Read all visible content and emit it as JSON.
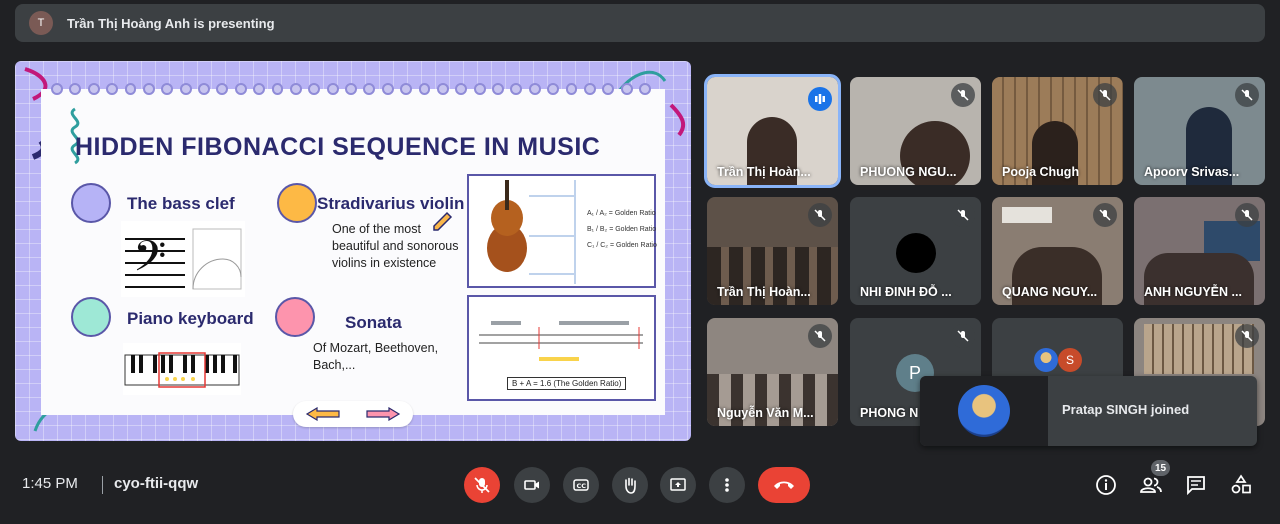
{
  "banner": {
    "presenter_initials": "T",
    "text": "Trần Thị Hoàng Anh is presenting"
  },
  "slide": {
    "title": "HIDDEN FIBONACCI SEQUENCE IN MUSIC",
    "bass_clef": "The bass clef",
    "violin_heading": "Stradivarius violin",
    "violin_text": "One of the most beautiful and sonorous violins in existence",
    "piano": "Piano keyboard",
    "sonata": "Sonata",
    "sonata_text": "Of Mozart, Beethoven, Bach,...",
    "ratio_lines": [
      "A₁ / A₂ = Golden Ratio",
      "B₁ / B₂ = Golden Ratio",
      "C₁ / C₂ = Golden Ratio"
    ],
    "golden_formula": "B + A = 1.6 (The Golden Ratio)",
    "accent_purple": "#b9b4f5",
    "circle_colors": [
      "#b6b3f6",
      "#fdb945",
      "#9ee8d6",
      "#fd94ad"
    ]
  },
  "participants": [
    {
      "name": "Trần Thị Hoàn...",
      "state": "speaking",
      "bg": "#d9d3cc"
    },
    {
      "name": "PHUONG NGU...",
      "state": "muted",
      "bg": "#b8b4ae"
    },
    {
      "name": "Pooja Chugh",
      "state": "muted",
      "bg": "#8b6f52"
    },
    {
      "name": "Apoorv Srivas...",
      "state": "muted",
      "bg": "#7d8a8f"
    },
    {
      "name": "Trần Thị Hoàn...",
      "state": "muted",
      "bg": "#5d5148"
    },
    {
      "name": "NHI ĐINH ĐỖ ...",
      "state": "muted",
      "bg": "#3c4043"
    },
    {
      "name": "QUANG NGUY...",
      "state": "muted",
      "bg": "#8a7d72"
    },
    {
      "name": "ANH NGUYỄN ...",
      "state": "muted",
      "bg": "#7b7071"
    },
    {
      "name": "Nguyễn Văn M...",
      "state": "muted",
      "bg": "#8e8680"
    },
    {
      "name": "PHONG N",
      "state": "muted",
      "bg": "#3c4043",
      "initial": "P"
    },
    {
      "name": "",
      "state": "none",
      "bg": "#3c4043",
      "initial": "S"
    },
    {
      "name": "",
      "state": "muted",
      "bg": "#8c8580"
    }
  ],
  "toast": {
    "text": "Pratap SINGH joined"
  },
  "bottom": {
    "time": "1:45 PM",
    "meeting_code": "cyo-ftii-qqw",
    "people_count": "15"
  },
  "colors": {
    "end_call": "#ea4335",
    "active_border": "#8ab4f8"
  }
}
